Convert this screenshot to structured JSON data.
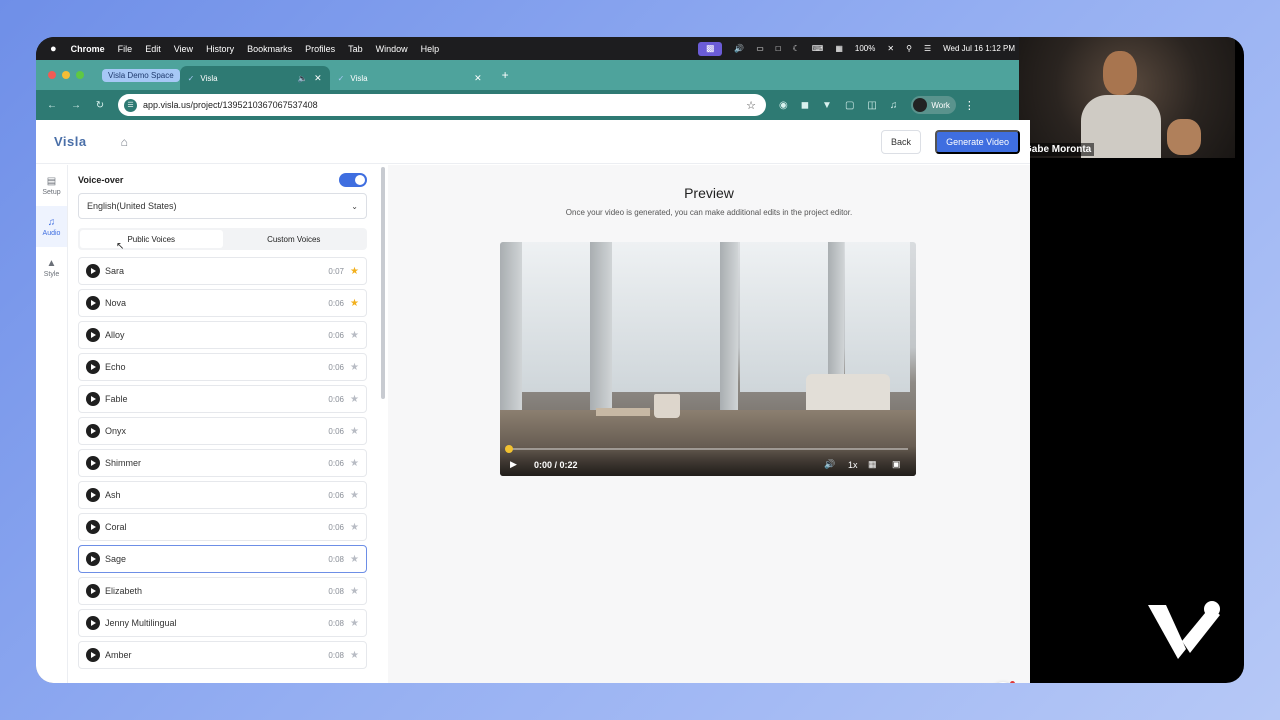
{
  "menubar": {
    "apple": "",
    "items": [
      "Chrome",
      "File",
      "Edit",
      "View",
      "History",
      "Bookmarks",
      "Profiles",
      "Tab",
      "Window",
      "Help"
    ],
    "battery": "100%",
    "datetime": "Wed Jul 16  1:12 PM"
  },
  "browser": {
    "tab_group": "Visla Demo Space",
    "tabs": [
      {
        "title": "Visla",
        "active": true
      },
      {
        "title": "Visla",
        "active": false
      }
    ],
    "url": "app.visla.us/project/1395210367067537408",
    "profile": "Work"
  },
  "webcam": {
    "name": "Gabe Moronta"
  },
  "app": {
    "brand": "Visla",
    "back_label": "Back",
    "generate_label": "Generate Video",
    "rail": [
      {
        "label": "Setup",
        "icon": "setup-icon"
      },
      {
        "label": "Audio",
        "icon": "music-note-icon"
      },
      {
        "label": "Style",
        "icon": "style-icon"
      }
    ],
    "voiceover": {
      "label": "Voice-over",
      "enabled": true,
      "language": "English(United States)",
      "tabs": [
        "Public Voices",
        "Custom Voices"
      ],
      "voices": [
        {
          "name": "Sara",
          "duration": "0:07",
          "favorite": true
        },
        {
          "name": "Nova",
          "duration": "0:06",
          "favorite": true
        },
        {
          "name": "Alloy",
          "duration": "0:06",
          "favorite": false
        },
        {
          "name": "Echo",
          "duration": "0:06",
          "favorite": false
        },
        {
          "name": "Fable",
          "duration": "0:06",
          "favorite": false
        },
        {
          "name": "Onyx",
          "duration": "0:06",
          "favorite": false
        },
        {
          "name": "Shimmer",
          "duration": "0:06",
          "favorite": false
        },
        {
          "name": "Ash",
          "duration": "0:06",
          "favorite": false
        },
        {
          "name": "Coral",
          "duration": "0:06",
          "favorite": false
        },
        {
          "name": "Sage",
          "duration": "0:08",
          "favorite": false,
          "selected": true
        },
        {
          "name": "Elizabeth",
          "duration": "0:08",
          "favorite": false
        },
        {
          "name": "Jenny Multilingual",
          "duration": "0:08",
          "favorite": false
        },
        {
          "name": "Amber",
          "duration": "0:08",
          "favorite": false
        }
      ]
    },
    "preview": {
      "title": "Preview",
      "subtitle": "Once your video is generated, you can make additional edits in the project editor.",
      "time": "0:00 / 0:22",
      "speed": "1x",
      "progress": 0
    }
  },
  "colors": {
    "accent": "#3f6ee0",
    "browser_tab": "#4ea39c",
    "browser_toolbar": "#2e7a73",
    "favorite": "#f2b01e"
  }
}
